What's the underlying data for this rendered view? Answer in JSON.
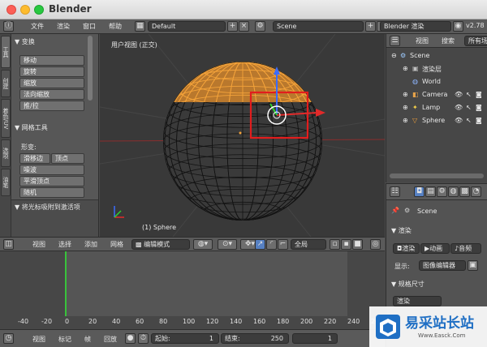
{
  "window": {
    "title": "Blender"
  },
  "info_header": {
    "menus": [
      "文件",
      "渲染",
      "窗口",
      "帮助"
    ],
    "screen_layout": "Default",
    "scene": "Scene",
    "render_engine": "Blender 渲染",
    "version": "v2.78"
  },
  "tool_shelf": {
    "tabs": [
      "工具",
      "创建",
      "着色/UV",
      "选项",
      "油笔"
    ],
    "transform_header": "变换",
    "transform_buttons": [
      "移动",
      "旋转",
      "缩放",
      "法向缩放",
      "推/拉"
    ],
    "mesh_tools_header": "网格工具",
    "deform_label": "形变:",
    "deform_row": [
      "滑移边",
      "顶点"
    ],
    "mesh_buttons": [
      "噪波",
      "平滑顶点",
      "随机"
    ],
    "footer": "将光标吸附到激活项"
  },
  "viewport": {
    "view_label": "用户视图 (正交)",
    "object_label": "(1) Sphere"
  },
  "outliner": {
    "tabs": [
      "视图",
      "搜索",
      "所有场"
    ],
    "items": [
      {
        "label": "Scene"
      },
      {
        "label": "渲染层"
      },
      {
        "label": "World"
      },
      {
        "label": "Camera"
      },
      {
        "label": "Lamp"
      },
      {
        "label": "Sphere"
      }
    ]
  },
  "properties": {
    "scene_name": "Scene",
    "render_header": "渲染",
    "render_buttons": [
      "渲染",
      "动画",
      "音频"
    ],
    "display_label": "显示:",
    "display_value": "图像编辑器",
    "dimensions_header": "规格尺寸",
    "render_field": "渲染"
  },
  "view3d_header": {
    "menus": [
      "视图",
      "选择",
      "添加",
      "网格"
    ],
    "mode": "编辑模式",
    "pivot": "全局"
  },
  "timeline": {
    "ticks": [
      "-40",
      "-20",
      "0",
      "20",
      "40",
      "60",
      "80",
      "100",
      "120",
      "140",
      "160",
      "180",
      "200",
      "220",
      "240",
      "260"
    ],
    "menus": [
      "视图",
      "标记",
      "帧",
      "回放"
    ],
    "start_label": "起始:",
    "start_value": "1",
    "end_label": "结束:",
    "end_value": "250",
    "current_frame": "1"
  },
  "watermark": {
    "text": "易采站长站",
    "subtext": "Www.Easck.Com"
  }
}
